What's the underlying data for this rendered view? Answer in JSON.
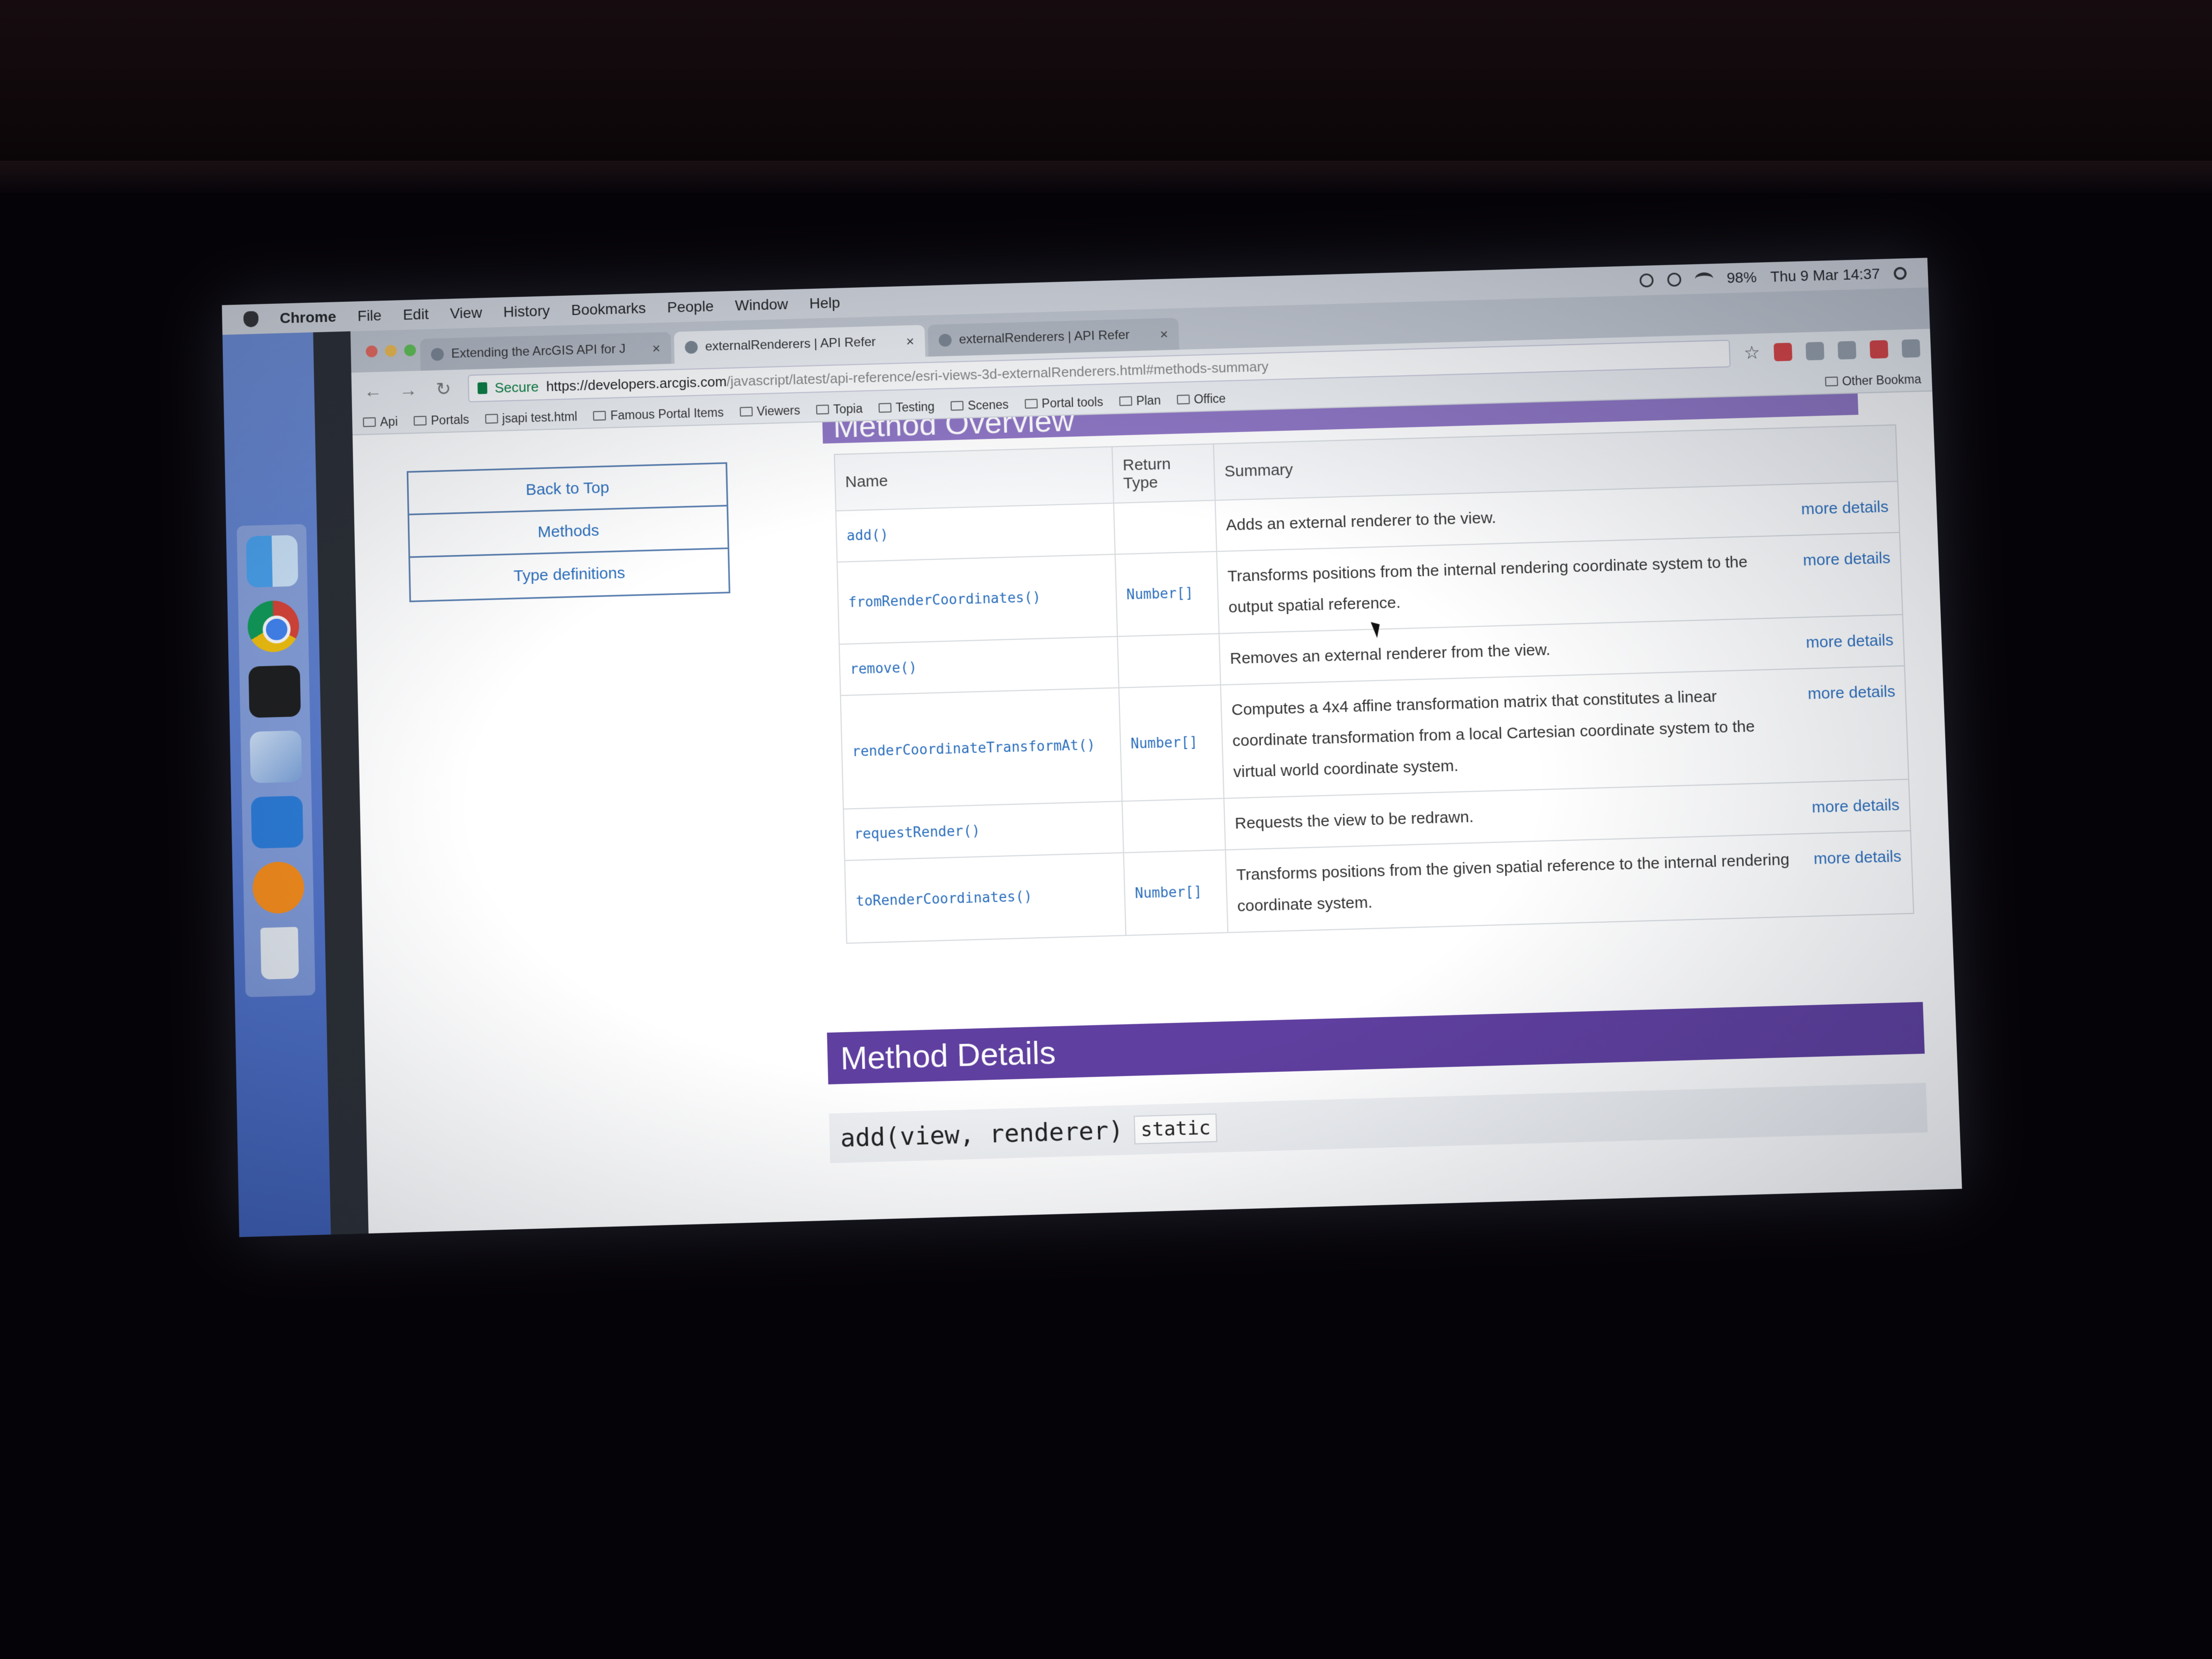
{
  "menubar": {
    "app": "Chrome",
    "items": [
      "File",
      "Edit",
      "View",
      "History",
      "Bookmarks",
      "People",
      "Window",
      "Help"
    ],
    "battery": "98%",
    "datetime": "Thu 9 Mar  14:37"
  },
  "tabs": [
    {
      "title": "Extending the ArcGIS API for J",
      "active": false
    },
    {
      "title": "externalRenderers | API Refer",
      "active": true
    },
    {
      "title": "externalRenderers | API Refer",
      "active": false
    }
  ],
  "omnibox": {
    "secure_label": "Secure",
    "url_host": "https://developers.arcgis.com",
    "url_path": "/javascript/latest/api-reference/esri-views-3d-externalRenderers.html#methods-summary"
  },
  "bookmarks": [
    "Api",
    "Portals",
    "jsapi test.html",
    "Famous Portal Items",
    "Viewers",
    "Topia",
    "Testing",
    "Scenes",
    "Portal tools",
    "Plan",
    "Office"
  ],
  "bookmarks_other": "Other Bookma",
  "side_nav": [
    "Back to Top",
    "Methods",
    "Type definitions"
  ],
  "overview_title": "Method Overview",
  "table": {
    "headers": {
      "name": "Name",
      "return_type": "Return Type",
      "summary": "Summary"
    },
    "rows": [
      {
        "name": "add()",
        "return_type": "",
        "summary": "Adds an external renderer to the view.",
        "link": "more details"
      },
      {
        "name": "fromRenderCoordinates()",
        "return_type": "Number[]",
        "summary": "Transforms positions from the internal rendering coordinate system to the output spatial reference.",
        "link": "more details"
      },
      {
        "name": "remove()",
        "return_type": "",
        "summary": "Removes an external renderer from the view.",
        "link": "more details"
      },
      {
        "name": "renderCoordinateTransformAt()",
        "return_type": "Number[]",
        "summary": "Computes a 4x4 affine transformation matrix that constitutes a linear coordinate transformation from a local Cartesian coordinate system to the virtual world coordinate system.",
        "link": "more details"
      },
      {
        "name": "requestRender()",
        "return_type": "",
        "summary": "Requests the view to be redrawn.",
        "link": "more details"
      },
      {
        "name": "toRenderCoordinates()",
        "return_type": "Number[]",
        "summary": "Transforms positions from the given spatial reference to the internal rendering coordinate system.",
        "link": "more details"
      }
    ]
  },
  "details_title": "Method Details",
  "signature": {
    "text": "add(view, renderer)",
    "badge": "static"
  },
  "colors": {
    "accent_purple": "#5f3f9f",
    "link_blue": "#2c6fbd"
  }
}
